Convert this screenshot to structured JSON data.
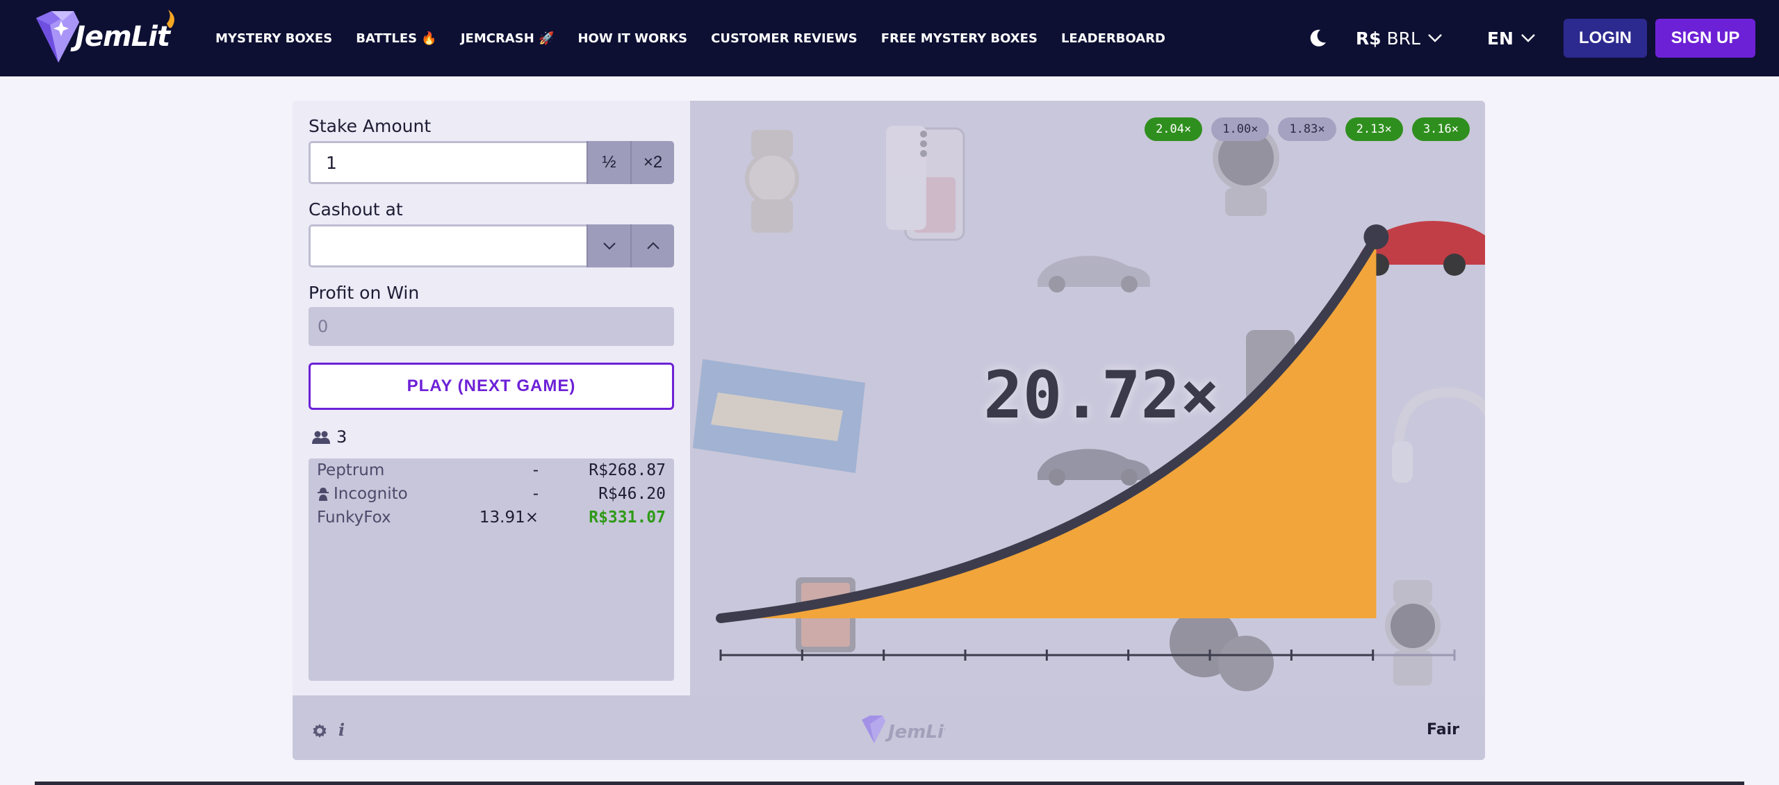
{
  "brand": {
    "name": "JemLit"
  },
  "nav": {
    "items": [
      "MYSTERY BOXES",
      "BATTLES 🔥",
      "JEMCRASH 🚀",
      "HOW IT WORKS",
      "CUSTOMER REVIEWS",
      "FREE MYSTERY BOXES",
      "LEADERBOARD"
    ]
  },
  "header": {
    "currency_symbol": "R$",
    "currency_code": "BRL",
    "language": "EN",
    "login": "LOGIN",
    "signup": "SIGN UP"
  },
  "form": {
    "stake_label": "Stake Amount",
    "stake_value": "1",
    "half_label": "½",
    "double_label": "×2",
    "cashout_label": "Cashout at",
    "cashout_value": "",
    "profit_label": "Profit on Win",
    "profit_value": "0",
    "play_label": "PLAY (NEXT GAME)"
  },
  "players": {
    "count": "3",
    "bets": [
      {
        "name": "Peptrum",
        "multiplier": "-",
        "profit": "R$268.87",
        "won": false,
        "incognito": false
      },
      {
        "name": "Incognito",
        "multiplier": "-",
        "profit": "R$46.20",
        "won": false,
        "incognito": true
      },
      {
        "name": "FunkyFox",
        "multiplier": "13.91×",
        "profit": "R$331.07",
        "won": true,
        "incognito": false
      }
    ]
  },
  "game": {
    "multiplier": "20.72×",
    "progress": 0.89,
    "history": [
      {
        "value": "2.04×",
        "color": "green"
      },
      {
        "value": "1.00×",
        "color": "grey"
      },
      {
        "value": "1.83×",
        "color": "grey"
      },
      {
        "value": "2.13×",
        "color": "green"
      },
      {
        "value": "3.16×",
        "color": "green"
      }
    ]
  },
  "footer": {
    "fair": "Fair"
  },
  "colors": {
    "accent": "#6d21d6",
    "nav_bg": "#0d1033",
    "curve_fill": "#f1a53a",
    "win": "#2e9a17"
  }
}
